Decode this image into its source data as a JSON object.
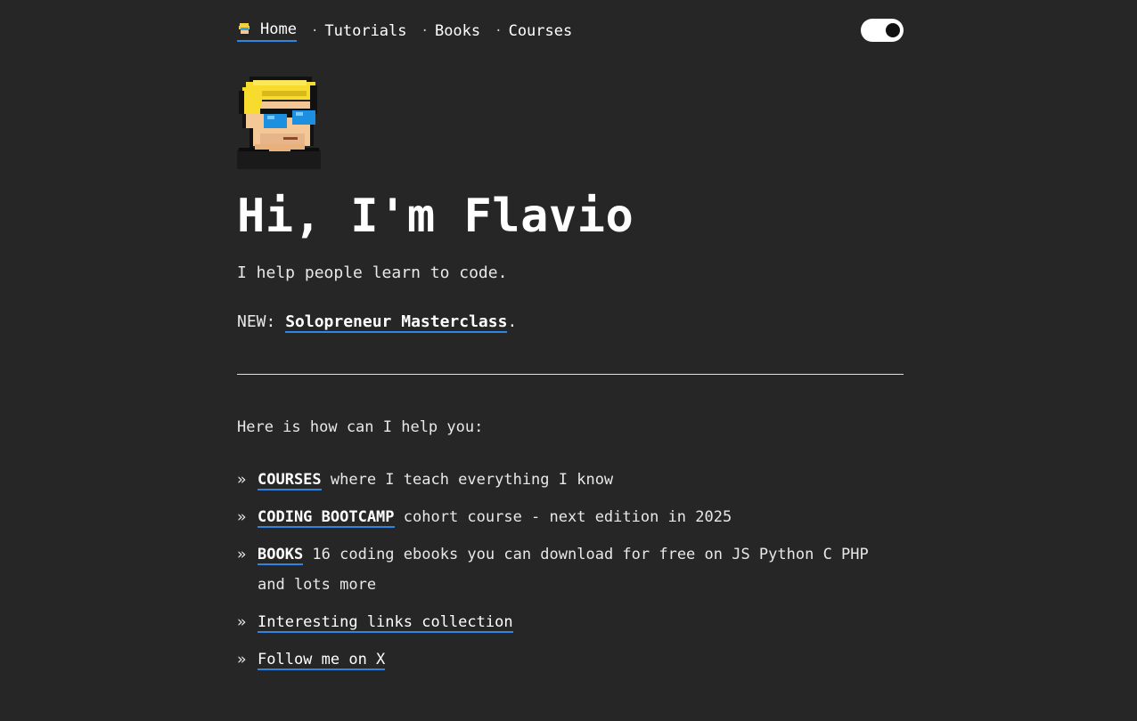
{
  "nav": {
    "home_label": "Home",
    "separator": "·",
    "tutorials_label": "Tutorials",
    "books_label": "Books",
    "courses_label": "Courses"
  },
  "hero": {
    "title": "Hi, I'm Flavio",
    "tagline": "I help people learn to code.",
    "new_prefix": "NEW: ",
    "new_link": "Solopreneur Masterclass",
    "new_suffix": "."
  },
  "help": {
    "intro": "Here is how can I help you:",
    "bullet": "»",
    "items": [
      {
        "link": "COURSES",
        "text": " where I teach everything I know"
      },
      {
        "link": "CODING BOOTCAMP",
        "text": " cohort course - next edition in 2025"
      },
      {
        "link": "BOOKS",
        "text": " 16 coding ebooks you can download for free on JS Python C PHP and lots more"
      },
      {
        "link": "Interesting links collection",
        "text": ""
      },
      {
        "link": "Follow me on X",
        "text": ""
      }
    ]
  },
  "colors": {
    "background": "#262626",
    "accent": "#2f86e0",
    "text": "#e8e8e8"
  },
  "icons": {
    "home": "site-logo-icon",
    "theme_toggle": "dark-mode-toggle"
  }
}
